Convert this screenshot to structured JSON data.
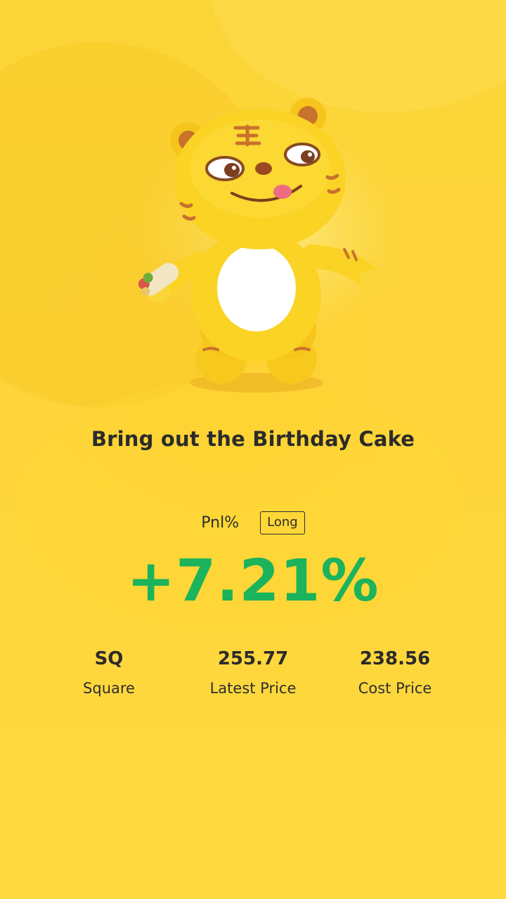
{
  "card": {
    "title": "Bring out the Birthday Cake",
    "mascot_icon": "tiger-mascot-icon"
  },
  "pnl": {
    "label": "Pnl%",
    "direction": "Long",
    "value": "+7.21%"
  },
  "stats": {
    "symbol": {
      "value": "SQ",
      "label": "Square"
    },
    "latest": {
      "value": "255.77",
      "label": "Latest Price"
    },
    "cost": {
      "value": "238.56",
      "label": "Cost Price"
    }
  },
  "colors": {
    "background": "#fdd63a",
    "gain": "#1bb35b",
    "text": "#2b2b2b"
  }
}
